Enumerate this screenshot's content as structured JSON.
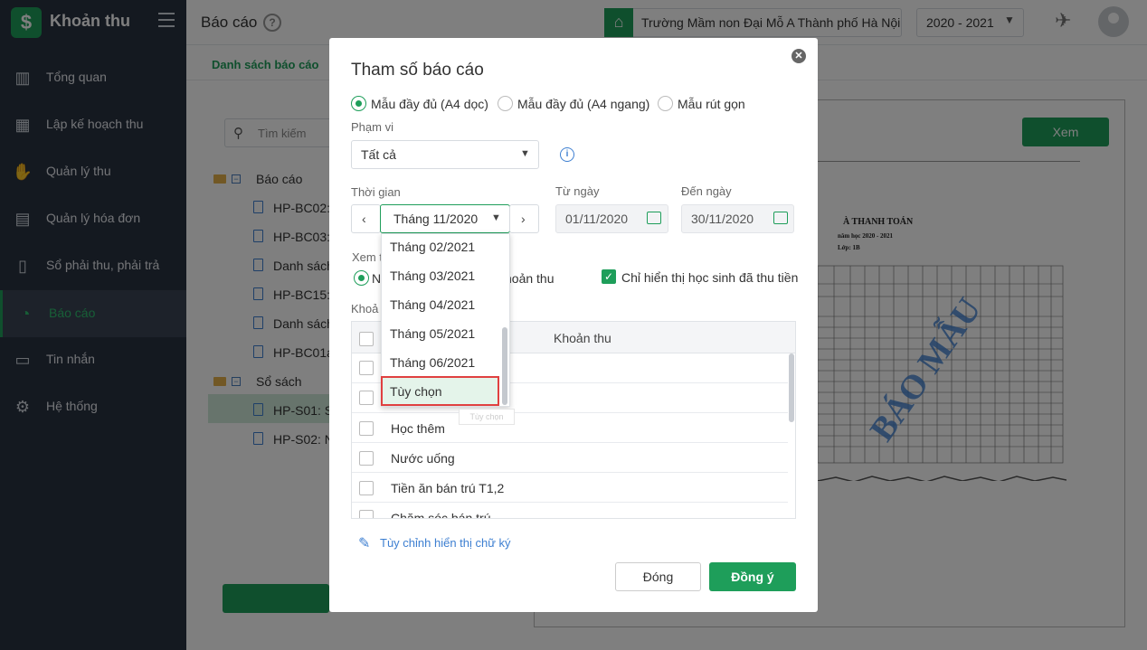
{
  "sidebar": {
    "app_name": "Khoản thu",
    "logo_glyph": "$",
    "items": [
      {
        "label": "Tổng quan",
        "icon": "bar-chart-icon"
      },
      {
        "label": "Lập kế hoạch thu",
        "icon": "calendar-money-icon"
      },
      {
        "label": "Quản lý thu",
        "icon": "hand-coin-icon"
      },
      {
        "label": "Quản lý hóa đơn",
        "icon": "invoice-icon"
      },
      {
        "label": "Sổ phải thu, phải trả",
        "icon": "ledger-icon"
      },
      {
        "label": "Báo cáo",
        "icon": "pie-chart-icon",
        "active": true
      },
      {
        "label": "Tin nhắn",
        "icon": "chat-icon"
      },
      {
        "label": "Hệ thống",
        "icon": "gear-icon"
      }
    ]
  },
  "header": {
    "title": "Báo cáo",
    "school": "Trường Mầm non Đại Mỗ A Thành phố Hà Nội",
    "year": "2020 - 2021"
  },
  "background": {
    "subtab": "Danh sách báo cáo",
    "search_placeholder": "Tìm kiếm",
    "tree": {
      "group1": "Báo cáo",
      "group1_items": [
        "HP-BC02: I",
        "HP-BC03: I",
        "Danh sách",
        "HP-BC15: I",
        "Danh sách",
        "HP-BC01a:"
      ],
      "group2": "Sổ sách",
      "group2_items": [
        "HP-S01: Sổ",
        "HP-S02: Nh"
      ]
    },
    "view_button": "Xem",
    "preview_title": "À THANH TOÁN",
    "preview_year": "năm học 2020 - 2021",
    "preview_class": "Lớp: 1B",
    "preview_stamp": "BÁO MẪU"
  },
  "modal": {
    "title": "Tham số báo cáo",
    "templates": [
      {
        "label": "Mẫu đầy đủ (A4 dọc)",
        "checked": true
      },
      {
        "label": "Mẫu đầy đủ (A4 ngang)",
        "checked": false
      },
      {
        "label": "Mẫu rút gọn",
        "checked": false
      }
    ],
    "scope_label": "Phạm vi",
    "scope_value": "Tất cả",
    "time_label": "Thời gian",
    "time_value": "Tháng 11/2020",
    "from_label": "Từ ngày",
    "from_value": "01/11/2020",
    "to_label": "Đến ngày",
    "to_value": "30/11/2020",
    "view_by_label": "Xem t",
    "view_by_option_partial": "N",
    "view_by_option2_partial": "hoản thu",
    "only_paid_label": "Chỉ hiển thị học sinh đã thu tiền",
    "only_paid_checked": true,
    "fees_label": "Khoả",
    "table_header": "Khoản thu",
    "fee_rows": [
      "",
      "",
      "Học thêm",
      "Nước uống",
      "Tiền ăn bán trú T1,2",
      "Chăm sóc bán trú"
    ],
    "signature_link": "Tùy chỉnh hiển thị chữ ký",
    "close_button": "Đóng",
    "ok_button": "Đồng ý"
  },
  "dropdown": {
    "options": [
      "Tháng 02/2021",
      "Tháng 03/2021",
      "Tháng 04/2021",
      "Tháng 05/2021",
      "Tháng 06/2021",
      "Tùy chọn"
    ],
    "highlighted": "Tùy chọn",
    "ghost_text": "Tùy chọn"
  },
  "colors": {
    "accent": "#1e9e5a",
    "sidebar": "#293241",
    "link": "#3d7fd1",
    "highlight_border": "#e04040"
  }
}
